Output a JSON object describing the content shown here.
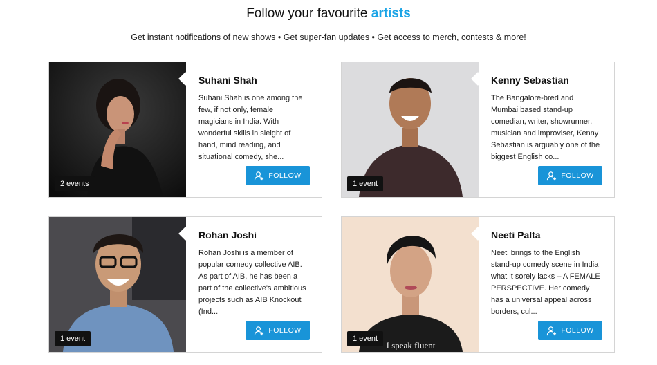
{
  "header": {
    "title": "Follow your favourite",
    "title_accent": "artists",
    "subtitle": "Get instant notifications of new shows • Get super-fan updates • Get access to merch, contests & more!"
  },
  "colors": {
    "accent": "#1ba4e6",
    "button": "#1994d8",
    "badge": "#111111"
  },
  "artists": [
    {
      "name": "Suhani Shah",
      "bio": "Suhani Shah is one among the few, if not only, female magicians in India. With wonderful skills in sleight of hand, mind reading, and situational comedy, she...",
      "events": "2 events",
      "follow_label": "FOLLOW",
      "follow_icon": "user-plus-icon"
    },
    {
      "name": "Kenny Sebastian",
      "bio": "The Bangalore-bred and Mumbai based stand-up comedian, writer, showrunner, musician and improviser, Kenny Sebastian is arguably one of the biggest English co...",
      "events": "1 event",
      "follow_label": "FOLLOW",
      "follow_icon": "user-plus-icon"
    },
    {
      "name": "Rohan Joshi",
      "bio": "Rohan Joshi is a member of popular comedy collective AIB. As part of AIB, he has been a part of the collective's ambitious projects such as AIB Knockout (Ind...",
      "events": "1 event",
      "follow_label": "FOLLOW",
      "follow_icon": "user-plus-icon"
    },
    {
      "name": "Neeti Palta",
      "bio": "Neeti brings to the English stand-up comedy scene in India what it sorely lacks – A FEMALE PERSPECTIVE. Her comedy has a universal appeal across borders, cul...",
      "events": "1 event",
      "follow_label": "FOLLOW",
      "follow_icon": "user-plus-icon",
      "shirt_text": "I speak fluent"
    }
  ]
}
